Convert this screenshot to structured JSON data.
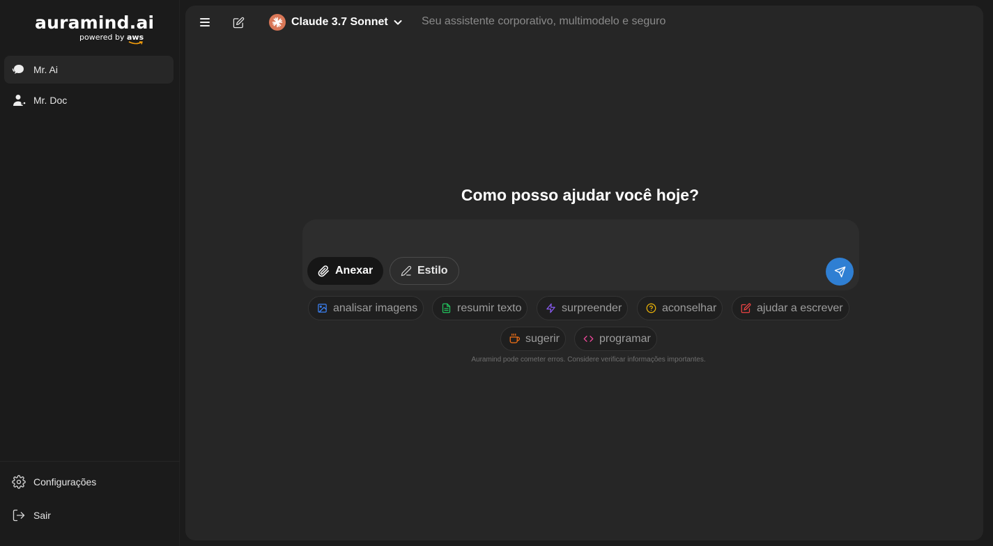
{
  "brand": {
    "name": "auramind.ai",
    "powered_prefix": "powered by",
    "powered_brand": "aws"
  },
  "sidebar": {
    "items": [
      {
        "label": "Mr. Ai",
        "icon": "chat-bubbles-icon",
        "active": true
      },
      {
        "label": "Mr. Doc",
        "icon": "doctor-icon",
        "active": false
      }
    ],
    "bottom": [
      {
        "label": "Configurações",
        "icon": "gear-icon"
      },
      {
        "label": "Sair",
        "icon": "logout-icon"
      }
    ]
  },
  "topbar": {
    "model_name": "Claude 3.7 Sonnet",
    "tagline": "Seu assistente corporativo, multimodelo e seguro"
  },
  "main": {
    "headline": "Como posso ajudar você hoje?",
    "composer": {
      "placeholder": "",
      "attach_label": "Anexar",
      "style_label": "Estilo"
    },
    "chips": [
      {
        "label": "analisar imagens",
        "icon": "image-icon",
        "color": "#3b82f6"
      },
      {
        "label": "resumir texto",
        "icon": "document-icon",
        "color": "#22c55e"
      },
      {
        "label": "surpreender",
        "icon": "lightning-icon",
        "color": "#8b5cf6"
      },
      {
        "label": "aconselhar",
        "icon": "help-circle-icon",
        "color": "#eab308"
      },
      {
        "label": "ajudar a escrever",
        "icon": "edit-icon",
        "color": "#ef4444"
      },
      {
        "label": "sugerir",
        "icon": "coffee-icon",
        "color": "#f97316"
      },
      {
        "label": "programar",
        "icon": "code-icon",
        "color": "#ec4899"
      }
    ],
    "disclaimer": "Auramind pode cometer erros. Considere verificar informações importantes."
  },
  "colors": {
    "accent": "#2f7fd3",
    "model_logo": "#d97757"
  }
}
